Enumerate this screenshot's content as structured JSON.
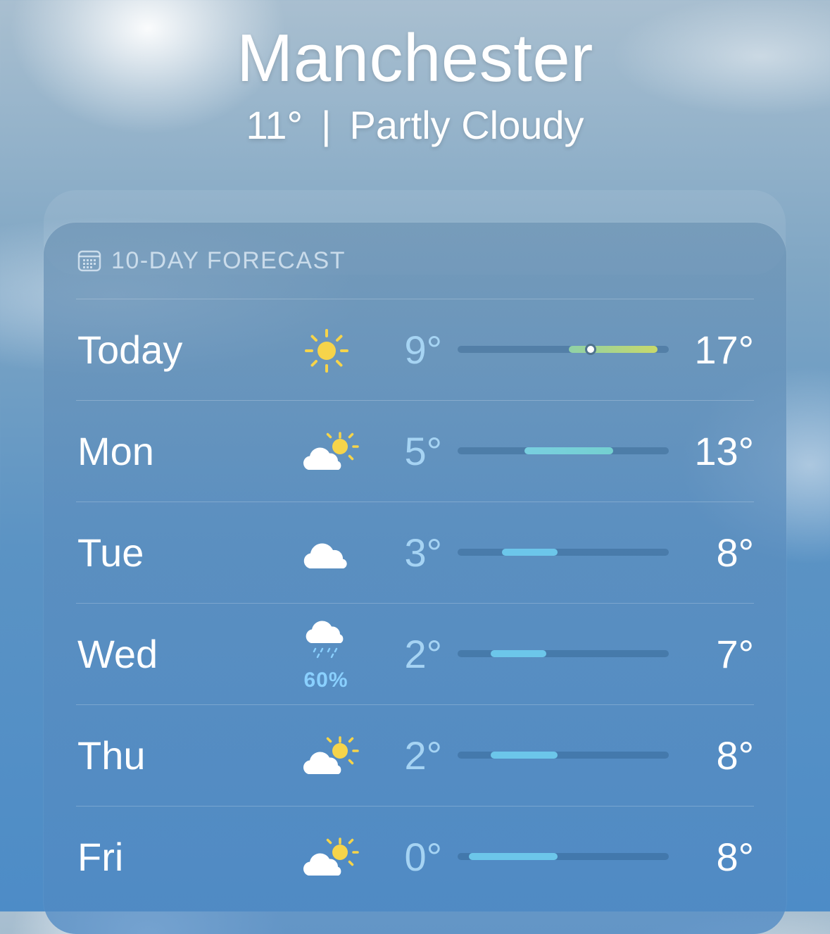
{
  "header": {
    "city": "Manchester",
    "current_temp": "11°",
    "separator": "|",
    "condition": "Partly Cloudy"
  },
  "forecast": {
    "title": "10-DAY FORECAST",
    "title_icon": "calendar-icon",
    "days": [
      {
        "day": "Today",
        "icon": "sun-icon",
        "low": "9°",
        "high": "17°",
        "precip": "",
        "range": [
          9,
          17
        ],
        "current": 11
      },
      {
        "day": "Mon",
        "icon": "partly-cloudy-icon",
        "low": "5°",
        "high": "13°",
        "precip": "",
        "range": [
          5,
          13
        ]
      },
      {
        "day": "Tue",
        "icon": "cloud-icon",
        "low": "3°",
        "high": "8°",
        "precip": "",
        "range": [
          3,
          8
        ]
      },
      {
        "day": "Wed",
        "icon": "cloud-drizzle-icon",
        "low": "2°",
        "high": "7°",
        "precip": "60%",
        "range": [
          2,
          7
        ]
      },
      {
        "day": "Thu",
        "icon": "partly-cloudy-icon",
        "low": "2°",
        "high": "8°",
        "precip": "",
        "range": [
          2,
          8
        ]
      },
      {
        "day": "Fri",
        "icon": "partly-cloudy-icon",
        "low": "0°",
        "high": "8°",
        "precip": "",
        "range": [
          0,
          8
        ]
      }
    ],
    "scale": [
      -1,
      18
    ],
    "colors": {
      "warm": "#c8d96a",
      "mild": "#7fcfe0",
      "cool": "#6cc6ea",
      "sun": "#f6d44a"
    }
  }
}
